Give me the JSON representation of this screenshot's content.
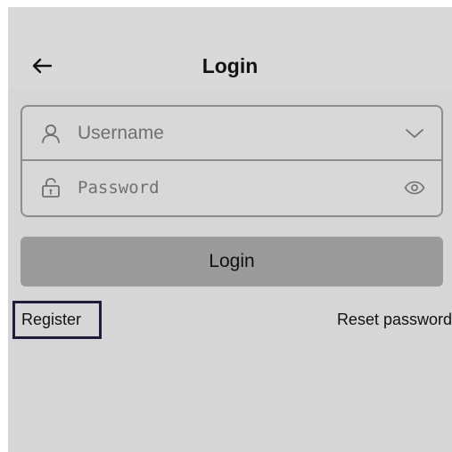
{
  "header": {
    "title": "Login",
    "back_icon": "arrow-left-icon"
  },
  "form": {
    "username": {
      "placeholder": "Username",
      "value": "",
      "icon": "user-icon",
      "action_icon": "chevron-down-icon"
    },
    "password": {
      "placeholder": "Password",
      "value": "",
      "icon": "lock-icon",
      "action_icon": "eye-icon"
    },
    "login_label": "Login"
  },
  "links": {
    "register": "Register",
    "reset_password": "Reset password"
  },
  "colors": {
    "background": "#d6d6d6",
    "button": "#9b9b9b",
    "border": "#8d8d8d",
    "highlight_border": "#1d1c3c"
  }
}
